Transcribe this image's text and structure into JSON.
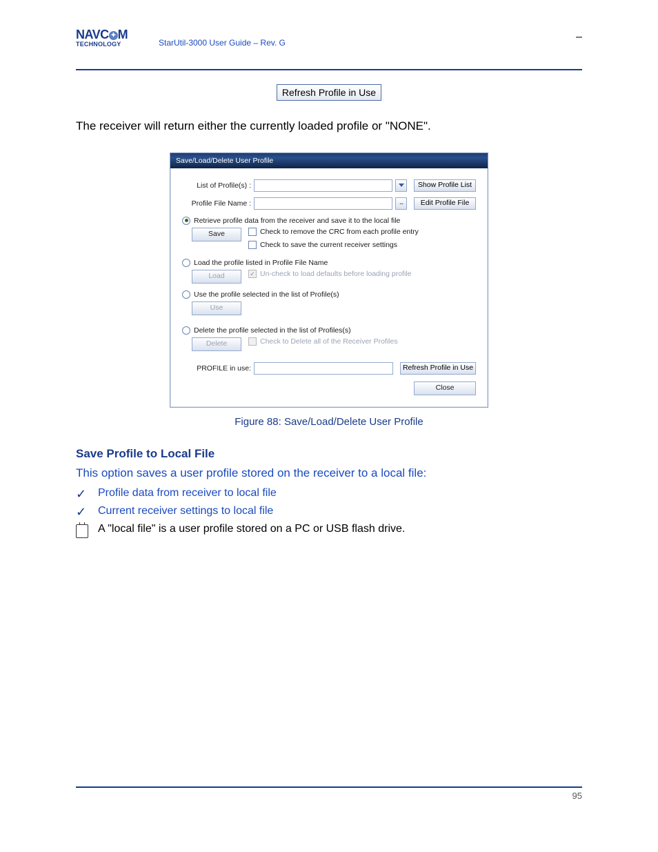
{
  "header": {
    "logo_top": "NAVC",
    "logo_top2": "M",
    "logo_bottom": "TECHNOLOGY",
    "subtitle": "StarUtil-3000 User Guide – Rev. G",
    "dash": "–"
  },
  "top_button": "Refresh Profile in Use",
  "para1": "The receiver will return either the currently loaded profile or \"NONE\".",
  "dialog": {
    "title": "Save/Load/Delete User Profile",
    "list_label": "List of Profile(s) :",
    "show_list": "Show Profile List",
    "file_label": "Profile File Name :",
    "edit_file": "Edit Profile File",
    "retrieve_radio": "Retrieve profile data from the receiver and save it to the local file",
    "save_btn": "Save",
    "cb_crc": "Check to remove the CRC from each profile entry",
    "cb_curr": "Check to save the current receiver settings",
    "load_radio": "Load the profile listed in Profile File Name",
    "load_btn": "Load",
    "cb_uncheck": "Un-check to load defaults before loading profile",
    "use_radio": "Use the profile selected in the list of Profile(s)",
    "use_btn": "Use",
    "delete_radio": "Delete the profile selected in the list of Profiles(s)",
    "delete_btn": "Delete",
    "cb_deleteall": "Check to Delete all of the Receiver Profiles",
    "profile_in_use": "PROFILE in use:",
    "refresh_btn": "Refresh Profile in Use",
    "close_btn": "Close"
  },
  "figure_caption": "Figure 88: Save/Load/Delete User Profile",
  "heading_save": "Save Profile to Local File",
  "save_para": "This option saves a user profile stored on the receiver to a local file:",
  "bullet1": "Profile data from receiver to local file",
  "bullet2": "Current receiver settings to local file",
  "note_text": "A \"local file\" is a user profile stored on a PC or USB flash drive.",
  "footer_left": "",
  "footer_right": "95"
}
